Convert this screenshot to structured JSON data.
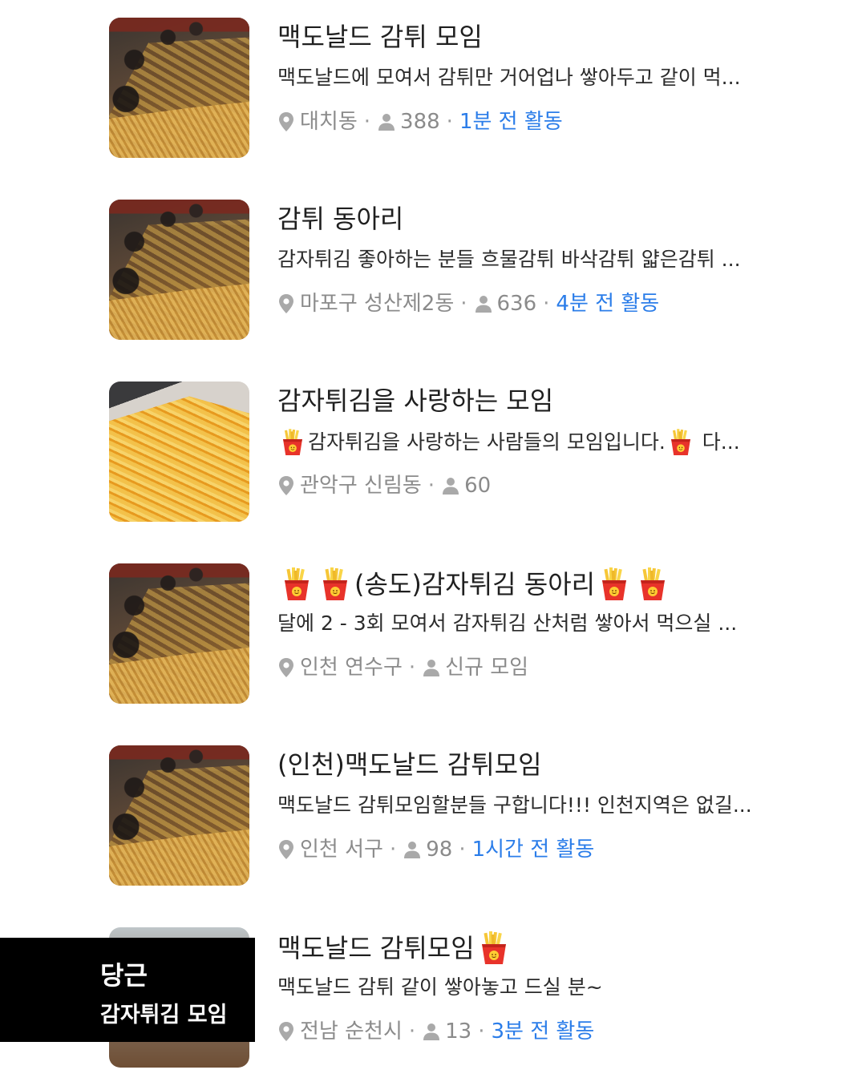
{
  "groups": [
    {
      "title": "맥도날드 감튀 모임",
      "desc": "맥도날드에 모여서 감튀만 거어업나 쌓아두고 같이 먹...",
      "location": "대치동",
      "members": "388",
      "activity": "1분 전 활동",
      "thumb_icon": "crowd-fries-photo"
    },
    {
      "title": "감튀 동아리",
      "desc": "감자튀김 좋아하는 분들 흐물감튀 바삭감튀 얇은감튀 ...",
      "location": "마포구 성산제2동",
      "members": "636",
      "activity": "4분 전 활동",
      "thumb_icon": "crowd-fries-photo"
    },
    {
      "title": "감자튀김을 사랑하는 모임",
      "desc_text": "감자튀김을 사랑하는 사람들의 모임입니다.",
      "desc_tail": "다...",
      "location": "관악구 신림동",
      "members": "60",
      "thumb_icon": "fries-pile-photo"
    },
    {
      "title_text": "(송도)감자튀김 동아리",
      "desc": "달에 2 - 3회 모여서 감자튀김 산처럼 쌓아서 먹으실  ...",
      "location": "인천 연수구",
      "members_label": "신규 모임",
      "thumb_icon": "crowd-fries-photo"
    },
    {
      "title": "(인천)맥도날드 감튀모임",
      "desc": "맥도날드 감튀모임할분들 구합니다!!! 인천지역은 없길...",
      "location": "인천 서구",
      "members": "98",
      "activity": "1시간 전 활동",
      "thumb_icon": "crowd-fries-photo"
    },
    {
      "title_text": "맥도날드 감튀모임",
      "desc": "맥도날드 감튀 같이 쌓아놓고 드실 분~",
      "location": "전남 순천시",
      "members": "13",
      "activity": "3분 전 활동",
      "thumb_icon": "crowd-fries-photo"
    }
  ],
  "caption": {
    "line1": "당근",
    "line2": "감자튀김 모임"
  },
  "colors": {
    "activity_blue": "#2b7de9",
    "meta_gray": "#8b8b8b",
    "caption_bg": "#000000"
  },
  "icons": {
    "location": "pin-icon",
    "members": "person-icon",
    "emoji": "french-fries-emoji"
  }
}
